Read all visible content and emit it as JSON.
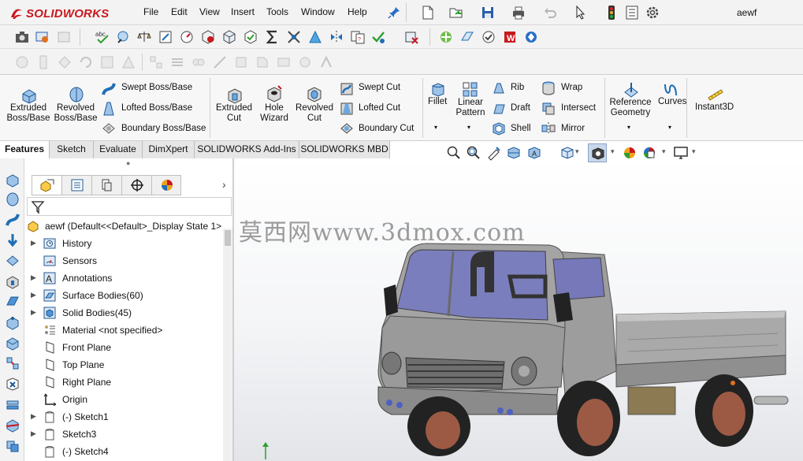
{
  "app": {
    "brand": "SOLIDWORKS",
    "document_title": "aewf"
  },
  "menu": [
    "File",
    "Edit",
    "View",
    "Insert",
    "Tools",
    "Window",
    "Help"
  ],
  "ribbon": {
    "boss": {
      "extruded": "Extruded\nBoss/Base",
      "revolved": "Revolved\nBoss/Base",
      "swept": "Swept Boss/Base",
      "lofted": "Lofted Boss/Base",
      "boundary": "Boundary Boss/Base"
    },
    "cut": {
      "extruded": "Extruded\nCut",
      "hole_wizard": "Hole\nWizard",
      "revolved": "Revolved\nCut",
      "swept": "Swept Cut",
      "lofted": "Lofted Cut",
      "boundary": "Boundary Cut"
    },
    "features": {
      "fillet": "Fillet",
      "linear_pattern": "Linear\nPattern",
      "rib": "Rib",
      "draft": "Draft",
      "shell": "Shell",
      "wrap": "Wrap",
      "intersect": "Intersect",
      "mirror": "Mirror",
      "reference_geometry": "Reference\nGeometry",
      "curves": "Curves",
      "instant3d": "Instant3D"
    }
  },
  "tabs": [
    "Features",
    "Sketch",
    "Evaluate",
    "DimXpert",
    "SOLIDWORKS Add-Ins",
    "SOLIDWORKS MBD"
  ],
  "tree": {
    "root": "aewf  (Default<<Default>_Display State 1>",
    "items": [
      {
        "label": "History",
        "icon": "history-icon",
        "expand": true
      },
      {
        "label": "Sensors",
        "icon": "sensors-icon",
        "expand": false
      },
      {
        "label": "Annotations",
        "icon": "annotations-icon",
        "expand": true
      },
      {
        "label": "Surface Bodies(60)",
        "icon": "surface-bodies-icon",
        "expand": true
      },
      {
        "label": "Solid Bodies(45)",
        "icon": "solid-bodies-icon",
        "expand": true
      },
      {
        "label": "Material <not specified>",
        "icon": "material-icon",
        "expand": false
      },
      {
        "label": "Front Plane",
        "icon": "plane-icon",
        "expand": false
      },
      {
        "label": "Top Plane",
        "icon": "plane-icon",
        "expand": false
      },
      {
        "label": "Right Plane",
        "icon": "plane-icon",
        "expand": false
      },
      {
        "label": "Origin",
        "icon": "origin-icon",
        "expand": false
      },
      {
        "label": "(-) Sketch1",
        "icon": "sketch-icon",
        "expand": true
      },
      {
        "label": "Sketch3",
        "icon": "sketch-icon",
        "expand": true
      },
      {
        "label": "(-) Sketch4",
        "icon": "sketch-icon",
        "expand": false
      }
    ]
  },
  "watermark": "莫西网www.3dmox.com",
  "colors": {
    "brand_red": "#c8181e",
    "accent_blue": "#1f6fb5"
  }
}
